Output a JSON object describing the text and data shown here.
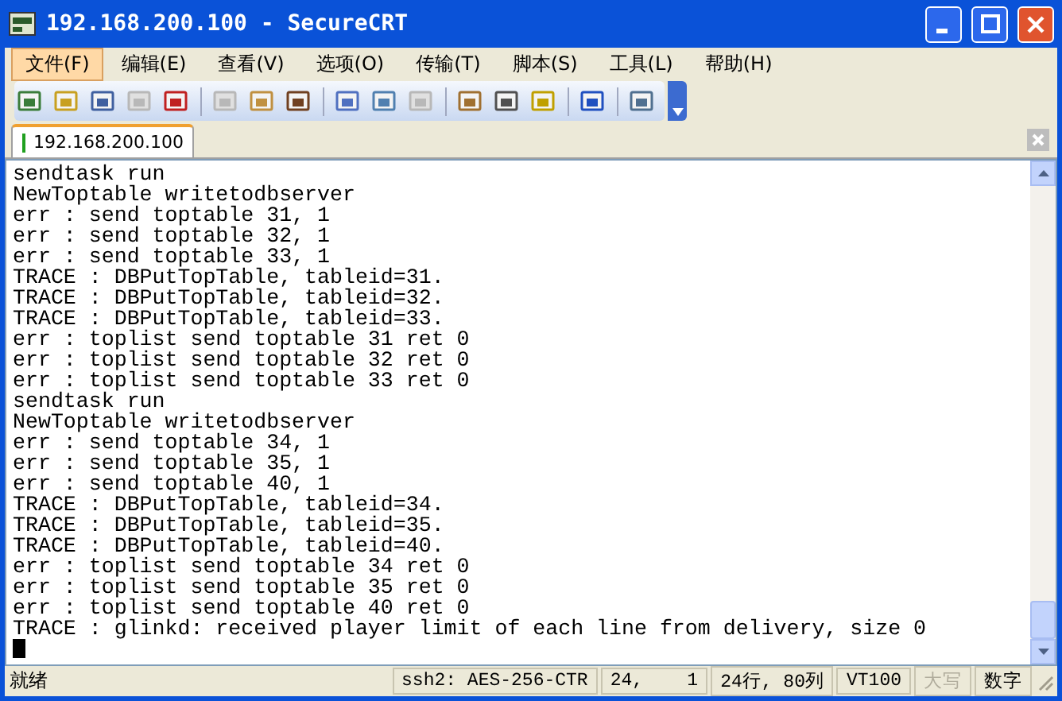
{
  "window": {
    "title": "192.168.200.100 - SecureCRT"
  },
  "menu": [
    {
      "label": "文件(F)",
      "selected": true
    },
    {
      "label": "编辑(E)",
      "selected": false
    },
    {
      "label": "查看(V)",
      "selected": false
    },
    {
      "label": "选项(O)",
      "selected": false
    },
    {
      "label": "传输(T)",
      "selected": false
    },
    {
      "label": "脚本(S)",
      "selected": false
    },
    {
      "label": "工具(L)",
      "selected": false
    },
    {
      "label": "帮助(H)",
      "selected": false
    }
  ],
  "toolbar": [
    {
      "kind": "button",
      "disabled": false
    },
    {
      "kind": "button",
      "disabled": false
    },
    {
      "kind": "button",
      "disabled": false
    },
    {
      "kind": "button",
      "disabled": true
    },
    {
      "kind": "button",
      "disabled": false
    },
    {
      "kind": "separator"
    },
    {
      "kind": "button",
      "disabled": true
    },
    {
      "kind": "button",
      "disabled": false
    },
    {
      "kind": "button",
      "disabled": false
    },
    {
      "kind": "separator"
    },
    {
      "kind": "button",
      "disabled": false
    },
    {
      "kind": "button",
      "disabled": false
    },
    {
      "kind": "button",
      "disabled": true
    },
    {
      "kind": "separator"
    },
    {
      "kind": "button",
      "disabled": false
    },
    {
      "kind": "button",
      "disabled": false
    },
    {
      "kind": "button",
      "disabled": false
    },
    {
      "kind": "separator"
    },
    {
      "kind": "button",
      "disabled": false
    },
    {
      "kind": "separator"
    },
    {
      "kind": "button",
      "disabled": false
    }
  ],
  "tabs": [
    {
      "label": "192.168.200.100",
      "selected": true
    }
  ],
  "terminal": {
    "lines": [
      "sendtask run",
      "NewToptable writetodbserver",
      "err : send toptable 31, 1",
      "err : send toptable 32, 1",
      "err : send toptable 33, 1",
      "TRACE : DBPutTopTable, tableid=31.",
      "TRACE : DBPutTopTable, tableid=32.",
      "TRACE : DBPutTopTable, tableid=33.",
      "err : toplist send toptable 31 ret 0",
      "err : toplist send toptable 32 ret 0",
      "err : toplist send toptable 33 ret 0",
      "sendtask run",
      "NewToptable writetodbserver",
      "err : send toptable 34, 1",
      "err : send toptable 35, 1",
      "err : send toptable 40, 1",
      "TRACE : DBPutTopTable, tableid=34.",
      "TRACE : DBPutTopTable, tableid=35.",
      "TRACE : DBPutTopTable, tableid=40.",
      "err : toplist send toptable 34 ret 0",
      "err : toplist send toptable 35 ret 0",
      "err : toplist send toptable 40 ret 0",
      "TRACE : glinkd: received player limit of each line from delivery, size 0"
    ],
    "cursor": true
  },
  "status_bar": {
    "message": "就绪",
    "panes": [
      {
        "text": "ssh2: AES-256-CTR",
        "disabled": false
      },
      {
        "text": "24,    1",
        "disabled": false
      },
      {
        "text": "24行, 80列",
        "disabled": false
      },
      {
        "text": "VT100",
        "disabled": false
      },
      {
        "text": "大写",
        "disabled": true
      },
      {
        "text": "数字",
        "disabled": false
      }
    ]
  }
}
